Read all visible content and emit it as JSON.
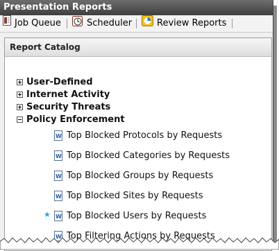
{
  "window": {
    "title": "Presentation Reports"
  },
  "toolbar": {
    "job_queue": "Job Queue",
    "scheduler": "Scheduler",
    "review_reports": "Review Reports"
  },
  "panel": {
    "title": "Report Catalog"
  },
  "tree": {
    "categories": [
      {
        "label": "User-Defined",
        "expanded": false
      },
      {
        "label": "Internet Activity",
        "expanded": false
      },
      {
        "label": "Security Threats",
        "expanded": false
      },
      {
        "label": "Policy Enforcement",
        "expanded": true
      }
    ],
    "reports": [
      {
        "label": "Top Blocked Protocols by Requests",
        "favorite": false
      },
      {
        "label": "Top Blocked Categories by Requests",
        "favorite": false
      },
      {
        "label": "Top Blocked Groups by Requests",
        "favorite": false
      },
      {
        "label": "Top Blocked Sites by Requests",
        "favorite": false
      },
      {
        "label": "Top Blocked Users by Requests",
        "favorite": true
      },
      {
        "label": "Top Filtering Actions by Requests",
        "favorite": false
      }
    ]
  },
  "icons": {
    "report_doc": "word-document-icon",
    "favorite": "star-icon",
    "job_queue": "job-queue-icon",
    "scheduler": "clock-icon",
    "review_reports": "review-reports-icon"
  },
  "colors": {
    "titlebar": "#4f4f4f",
    "star": "#27a4e0"
  }
}
